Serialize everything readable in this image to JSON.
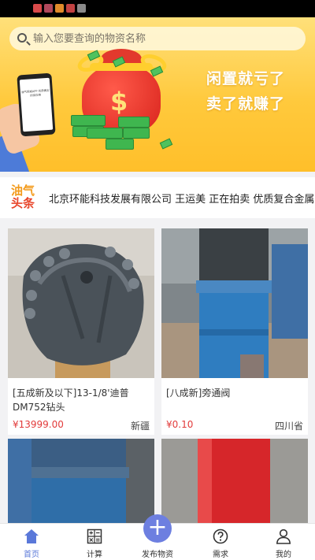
{
  "status_bar": {
    "icons": [
      "notification-icon-1",
      "notification-icon-2",
      "notification-icon-3",
      "notification-icon-4",
      "notification-icon-5"
    ],
    "icon_colors": [
      "#d84a4a",
      "#b0485c",
      "#e08b2a",
      "#c24242",
      "#8a8a8a"
    ]
  },
  "search": {
    "placeholder": "输入您要查询的物资名称"
  },
  "banner": {
    "slogan_line1": "闲置就亏了",
    "slogan_line2": "卖了就赚了",
    "phone_text": "油气同城APP 优质真实的供应商"
  },
  "ticker": {
    "logo_top": "油气",
    "logo_bottom": "头条",
    "text": "北京环能科技发展有限公司 王运美 正在拍卖 优质复合金属网布管"
  },
  "products": [
    {
      "title": "[五成新及以下]13-1/8'迪普DM752钻头",
      "price": "¥13999.00",
      "location": "新疆"
    },
    {
      "title": "[八成新]旁通阀",
      "price": "¥0.10",
      "location": "四川省"
    },
    {
      "title": "",
      "price": "",
      "location": ""
    },
    {
      "title": "",
      "price": "",
      "location": ""
    }
  ],
  "tabbar": {
    "items": [
      {
        "label": "首页",
        "icon": "home-icon",
        "active": true
      },
      {
        "label": "计算",
        "icon": "calculator-icon",
        "active": false
      },
      {
        "label": "发布物资",
        "icon": "plus-icon",
        "active": false
      },
      {
        "label": "需求",
        "icon": "question-icon",
        "active": false
      },
      {
        "label": "我的",
        "icon": "user-icon",
        "active": false
      }
    ]
  },
  "colors": {
    "accent": "#5a78d9",
    "price": "#e23b3b",
    "banner": "#ffc93c"
  }
}
